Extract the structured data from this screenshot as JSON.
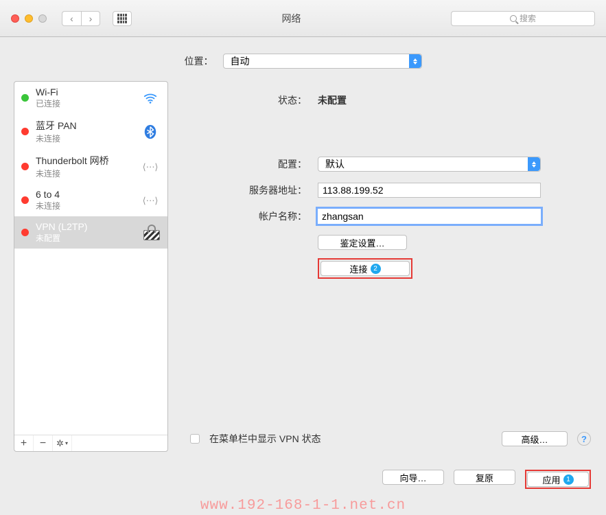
{
  "titlebar": {
    "title": "网络",
    "search_placeholder": "搜索"
  },
  "location": {
    "label": "位置：",
    "value": "自动"
  },
  "sidebar": {
    "items": [
      {
        "name": "Wi-Fi",
        "status": "已连接",
        "dot": "green",
        "icon": "wifi"
      },
      {
        "name": "蓝牙 PAN",
        "status": "未连接",
        "dot": "red",
        "icon": "bluetooth"
      },
      {
        "name": "Thunderbolt 网桥",
        "status": "未连接",
        "dot": "red",
        "icon": "ethernet"
      },
      {
        "name": "6 to 4",
        "status": "未连接",
        "dot": "red",
        "icon": "ethernet"
      },
      {
        "name": "VPN (L2TP)",
        "status": "未配置",
        "dot": "red",
        "icon": "lock"
      }
    ]
  },
  "main": {
    "status_label": "状态：",
    "status_value": "未配置",
    "config_label": "配置：",
    "config_value": "默认",
    "server_label": "服务器地址：",
    "server_value": "113.88.199.52",
    "account_label": "帐户名称：",
    "account_value": "zhangsan",
    "auth_btn": "鉴定设置…",
    "connect_btn": "连接",
    "connect_badge": "2",
    "menu_checkbox_label": "在菜单栏中显示 VPN 状态",
    "advanced_btn": "高级…"
  },
  "footer": {
    "wizard_btn": "向导…",
    "revert_btn": "复原",
    "apply_btn": "应用",
    "apply_badge": "1"
  },
  "watermark": "www.192-168-1-1.net.cn"
}
